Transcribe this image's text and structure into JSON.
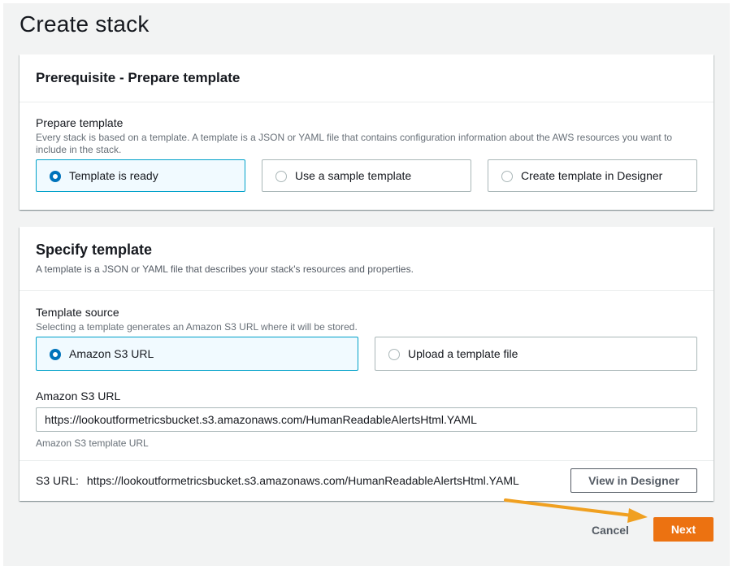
{
  "page": {
    "title": "Create stack"
  },
  "prerequisite": {
    "title": "Prerequisite - Prepare template",
    "field_label": "Prepare template",
    "field_desc": "Every stack is based on a template. A template is a JSON or YAML file that contains configuration information about the AWS resources you want to include in the stack.",
    "options": [
      {
        "label": "Template is ready",
        "selected": true
      },
      {
        "label": "Use a sample template",
        "selected": false
      },
      {
        "label": "Create template in Designer",
        "selected": false
      }
    ]
  },
  "specify": {
    "title": "Specify template",
    "desc": "A template is a JSON or YAML file that describes your stack's resources and properties.",
    "source_label": "Template source",
    "source_desc": "Selecting a template generates an Amazon S3 URL where it will be stored.",
    "options": [
      {
        "label": "Amazon S3 URL",
        "selected": true
      },
      {
        "label": "Upload a template file",
        "selected": false
      }
    ],
    "url_label": "Amazon S3 URL",
    "url_value": "https://lookoutformetricsbucket.s3.amazonaws.com/HumanReadableAlertsHtml.YAML",
    "url_hint": "Amazon S3 template URL",
    "s3_key": "S3 URL:",
    "s3_value": "https://lookoutformetricsbucket.s3.amazonaws.com/HumanReadableAlertsHtml.YAML",
    "designer_button": "View in Designer"
  },
  "footer": {
    "cancel": "Cancel",
    "next": "Next"
  },
  "colors": {
    "primary_button": "#ec7211",
    "selected_border": "#00a1c9",
    "radio_selected": "#0073bb",
    "annotation_arrow": "#f0a020"
  },
  "icons": {
    "annotation": "arrow-right-icon"
  }
}
